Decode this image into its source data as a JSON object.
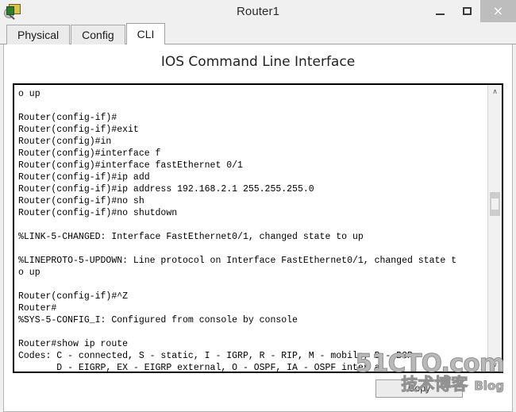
{
  "window": {
    "title": "Router1",
    "icon": "router-magnifier-icon",
    "controls": {
      "minimize": "–",
      "maximize": "□",
      "close": "×"
    }
  },
  "tabs": [
    {
      "label": "Physical",
      "active": false
    },
    {
      "label": "Config",
      "active": false
    },
    {
      "label": "CLI",
      "active": true
    }
  ],
  "panel": {
    "heading": "IOS Command Line Interface"
  },
  "terminal": {
    "lines": [
      "o up",
      "",
      "Router(config-if)#",
      "Router(config-if)#exit",
      "Router(config)#in",
      "Router(config)#interface f",
      "Router(config)#interface fastEthernet 0/1",
      "Router(config-if)#ip add",
      "Router(config-if)#ip address 192.168.2.1 255.255.255.0",
      "Router(config-if)#no sh",
      "Router(config-if)#no shutdown",
      "",
      "%LINK-5-CHANGED: Interface FastEthernet0/1, changed state to up",
      "",
      "%LINEPROTO-5-UPDOWN: Line protocol on Interface FastEthernet0/1, changed state t",
      "o up",
      "",
      "Router(config-if)#^Z",
      "Router#",
      "%SYS-5-CONFIG_I: Configured from console by console",
      "",
      "Router#show ip route",
      "Codes: C - connected, S - static, I - IGRP, R - RIP, M - mobile, B - BGP",
      "       D - EIGRP, EX - EIGRP external, O - OSPF, IA - OSPF inter a"
    ],
    "scrollbar": {
      "up_arrow": "∧",
      "down_arrow": "∨"
    }
  },
  "bottom": {
    "copy_paste_label": "Copy"
  },
  "watermark": {
    "main": "51CTO.com",
    "chinese": "技术博客",
    "blog": "Blog"
  },
  "colors": {
    "window_bg": "#f0f0f0",
    "panel_bg": "#ffffff",
    "terminal_border": "#000000",
    "close_button": "#bdbdbd",
    "scrollbar_track": "#f1f1f1",
    "scrollbar_thumb": "#cdcdcd"
  }
}
